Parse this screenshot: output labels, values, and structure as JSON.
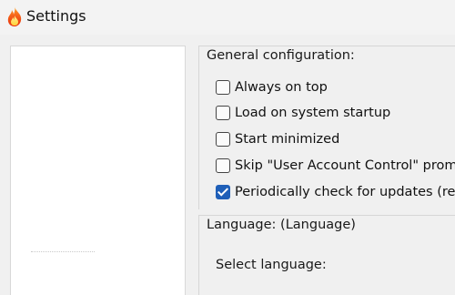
{
  "window": {
    "title": "Settings",
    "icon": "flame-icon",
    "accent_color": "#1f5fb8"
  },
  "general": {
    "heading": "General configuration:",
    "options": [
      {
        "label": "Always on top",
        "checked": false
      },
      {
        "label": "Load on system startup",
        "checked": false
      },
      {
        "label": "Start minimized",
        "checked": false
      },
      {
        "label": "Skip \"User Account Control\" prompt",
        "checked": false
      },
      {
        "label": "Periodically check for updates (recommended)",
        "checked": true
      }
    ]
  },
  "language": {
    "heading": "Language: (Language)",
    "select_label": "Select language:"
  }
}
